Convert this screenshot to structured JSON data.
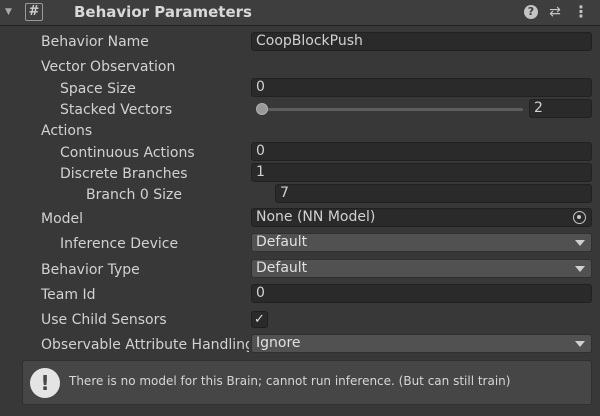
{
  "header": {
    "title": "Behavior Parameters",
    "foldout_glyph": "▼",
    "script_icon_glyph": "#",
    "help_glyph": "?",
    "preset_glyph": "⇄",
    "menu_glyph": "⋮"
  },
  "fields": {
    "behavior_name_label": "Behavior Name",
    "behavior_name_value": "CoopBlockPush",
    "vector_observation_label": "Vector Observation",
    "space_size_label": "Space Size",
    "space_size_value": "0",
    "stacked_vectors_label": "Stacked Vectors",
    "stacked_vectors_value": "2",
    "actions_label": "Actions",
    "continuous_actions_label": "Continuous Actions",
    "continuous_actions_value": "0",
    "discrete_branches_label": "Discrete Branches",
    "discrete_branches_value": "1",
    "branch0_label": "Branch 0 Size",
    "branch0_value": "7",
    "model_label": "Model",
    "model_value": "None (NN Model)",
    "inference_device_label": "Inference Device",
    "inference_device_value": "Default",
    "behavior_type_label": "Behavior Type",
    "behavior_type_value": "Default",
    "team_id_label": "Team Id",
    "team_id_value": "0",
    "use_child_sensors_label": "Use Child Sensors",
    "use_child_sensors_checked": true,
    "check_glyph": "✓",
    "observable_label": "Observable Attribute Handling",
    "observable_value": "Ignore"
  },
  "helpbox": {
    "icon_glyph": "!",
    "message": "There is no model for this Brain; cannot run inference. (But can still train)"
  }
}
